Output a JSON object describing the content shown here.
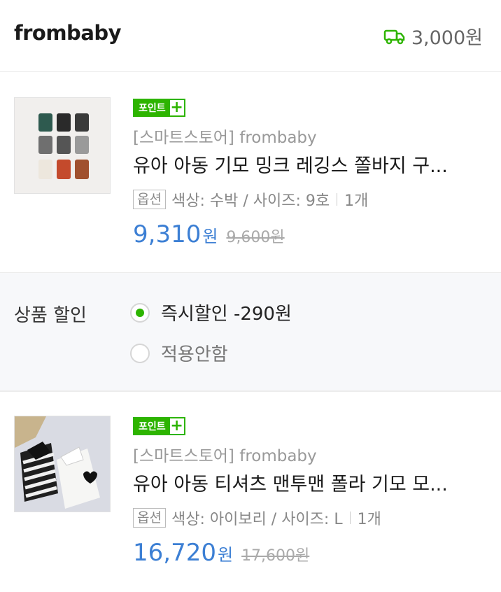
{
  "header": {
    "store_name": "frombaby",
    "shipping_icon": "truck-icon",
    "shipping_fee": "3,000원",
    "shipping_color": "#2db400"
  },
  "items": [
    {
      "badge": "포인트",
      "badge_plus": "+",
      "seller": "[스마트스토어] frombaby",
      "title": "유아 아동 기모 밍크 레깅스 쫄바지 구...",
      "option_tag": "옵션",
      "option": "색상: 수박 / 사이즈: 9호",
      "quantity": "1개",
      "price": "9,310",
      "price_unit": "원",
      "original_price": "9,600원"
    },
    {
      "badge": "포인트",
      "badge_plus": "+",
      "seller": "[스마트스토어] frombaby",
      "title": "유아 아동 티셔츠 맨투맨 폴라 기모 모...",
      "option_tag": "옵션",
      "option": "색상: 아이보리 / 사이즈: L",
      "quantity": "1개",
      "price": "16,720",
      "price_unit": "원",
      "original_price": "17,600원"
    }
  ],
  "discount": {
    "label": "상품 할인",
    "options": [
      {
        "label": "즉시할인 -290원",
        "selected": true
      },
      {
        "label": "적용안함",
        "selected": false
      }
    ]
  },
  "colors": {
    "accent_green": "#2db400",
    "price_blue": "#3c7fd4"
  }
}
